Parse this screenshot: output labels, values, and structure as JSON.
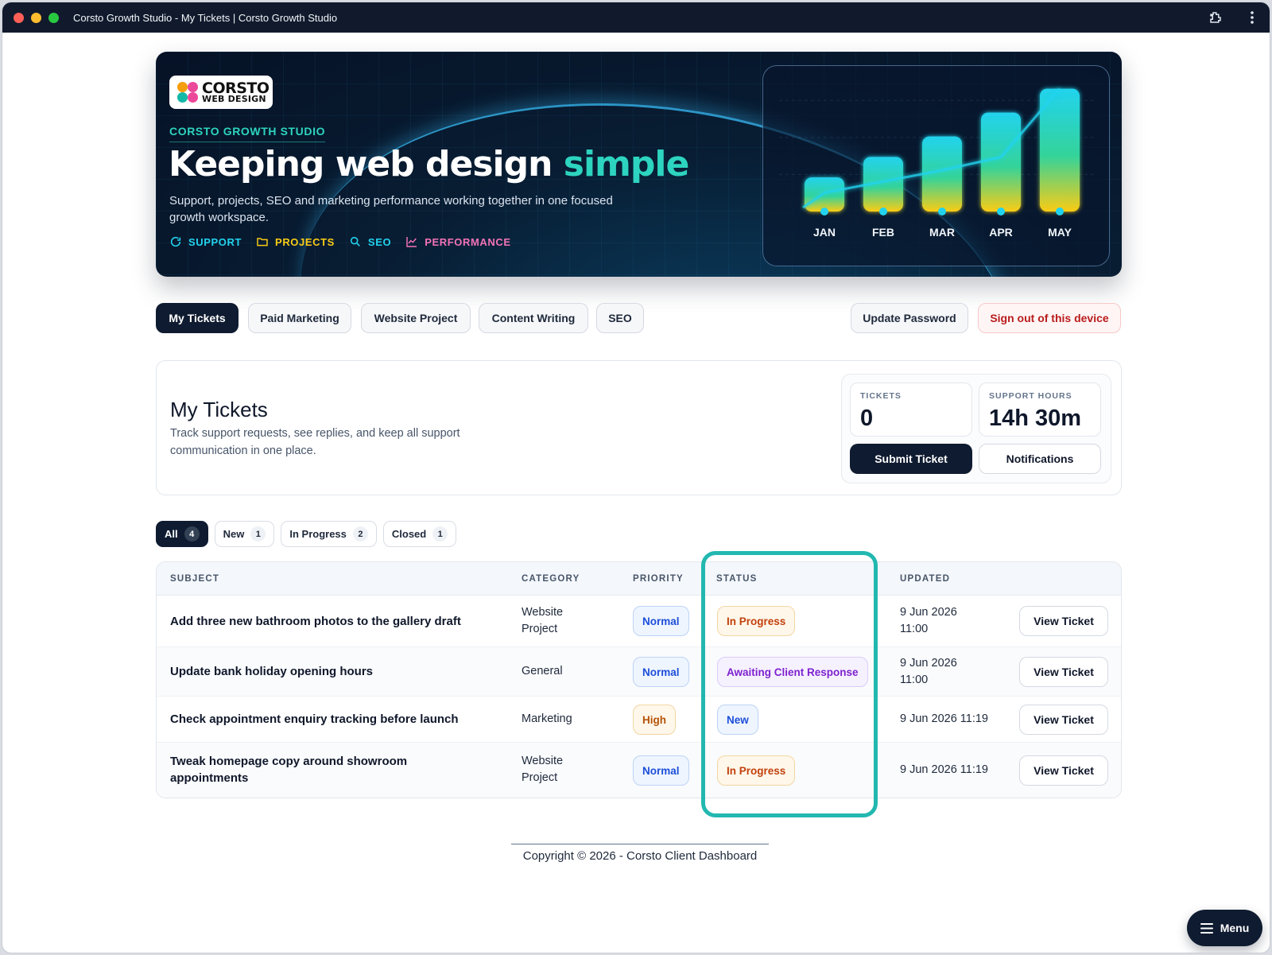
{
  "window": {
    "title": "Corsto Growth Studio - My Tickets | Corsto Growth Studio"
  },
  "hero": {
    "logo_line1": "CORSTO",
    "logo_line2": "WEB DESIGN",
    "eyebrow": "CORSTO GROWTH STUDIO",
    "headline_main": "Keeping web design ",
    "headline_accent": "simple",
    "description": "Support, projects, SEO and marketing performance working together in one focused growth workspace.",
    "tags": {
      "support": "SUPPORT",
      "projects": "PROJECTS",
      "seo": "SEO",
      "performance": "PERFORMANCE"
    },
    "colors": {
      "accent": "#2dd4bf",
      "support": "#22d3ee",
      "projects": "#facc15",
      "performance": "#f472b6"
    }
  },
  "chart_data": {
    "type": "bar",
    "categories": [
      "JAN",
      "FEB",
      "MAR",
      "APR",
      "MAY"
    ],
    "values": [
      1,
      1.6,
      2.2,
      2.9,
      3.6
    ],
    "title": "",
    "xlabel": "",
    "ylabel": "",
    "ylim": [
      0,
      3.8
    ],
    "grid": true,
    "legend": "none"
  },
  "nav": {
    "tabs": [
      "My Tickets",
      "Paid Marketing",
      "Website Project",
      "Content Writing",
      "SEO"
    ],
    "update_password": "Update Password",
    "sign_out": "Sign out of this device"
  },
  "summary": {
    "title": "My Tickets",
    "description": "Track support requests, see replies, and keep all support communication in one place.",
    "tickets_label": "TICKETS",
    "tickets_value": "0",
    "hours_label": "SUPPORT HOURS",
    "hours_value": "14h 30m",
    "submit_label": "Submit Ticket",
    "notifications_label": "Notifications"
  },
  "filters": [
    {
      "label": "All",
      "count": "4"
    },
    {
      "label": "New",
      "count": "1"
    },
    {
      "label": "In Progress",
      "count": "2"
    },
    {
      "label": "Closed",
      "count": "1"
    }
  ],
  "table": {
    "headers": {
      "subject": "SUBJECT",
      "category": "CATEGORY",
      "priority": "PRIORITY",
      "status": "STATUS",
      "updated": "UPDATED"
    },
    "rows": [
      {
        "subject": "Add three new bathroom photos to the gallery draft",
        "category": "Website Project",
        "priority": "Normal",
        "status": "In Progress",
        "updated": "9 Jun 2026 11:00",
        "action": "View Ticket"
      },
      {
        "subject": "Update bank holiday opening hours",
        "category": "General",
        "priority": "Normal",
        "status": "Awaiting Client Response",
        "updated": "9 Jun 2026 11:00",
        "action": "View Ticket"
      },
      {
        "subject": "Check appointment enquiry tracking before launch",
        "category": "Marketing",
        "priority": "High",
        "status": "New",
        "updated": "9 Jun 2026 11:19",
        "action": "View Ticket"
      },
      {
        "subject": "Tweak homepage copy around showroom appointments",
        "category": "Website Project",
        "priority": "Normal",
        "status": "In Progress",
        "updated": "9 Jun 2026 11:19",
        "action": "View Ticket"
      }
    ]
  },
  "footer": {
    "copyright": "Copyright © 2026 - Corsto Client Dashboard"
  },
  "menu": {
    "label": "Menu"
  },
  "colors": {
    "highlight": "#22b8b0",
    "dark": "#0f1b30"
  }
}
